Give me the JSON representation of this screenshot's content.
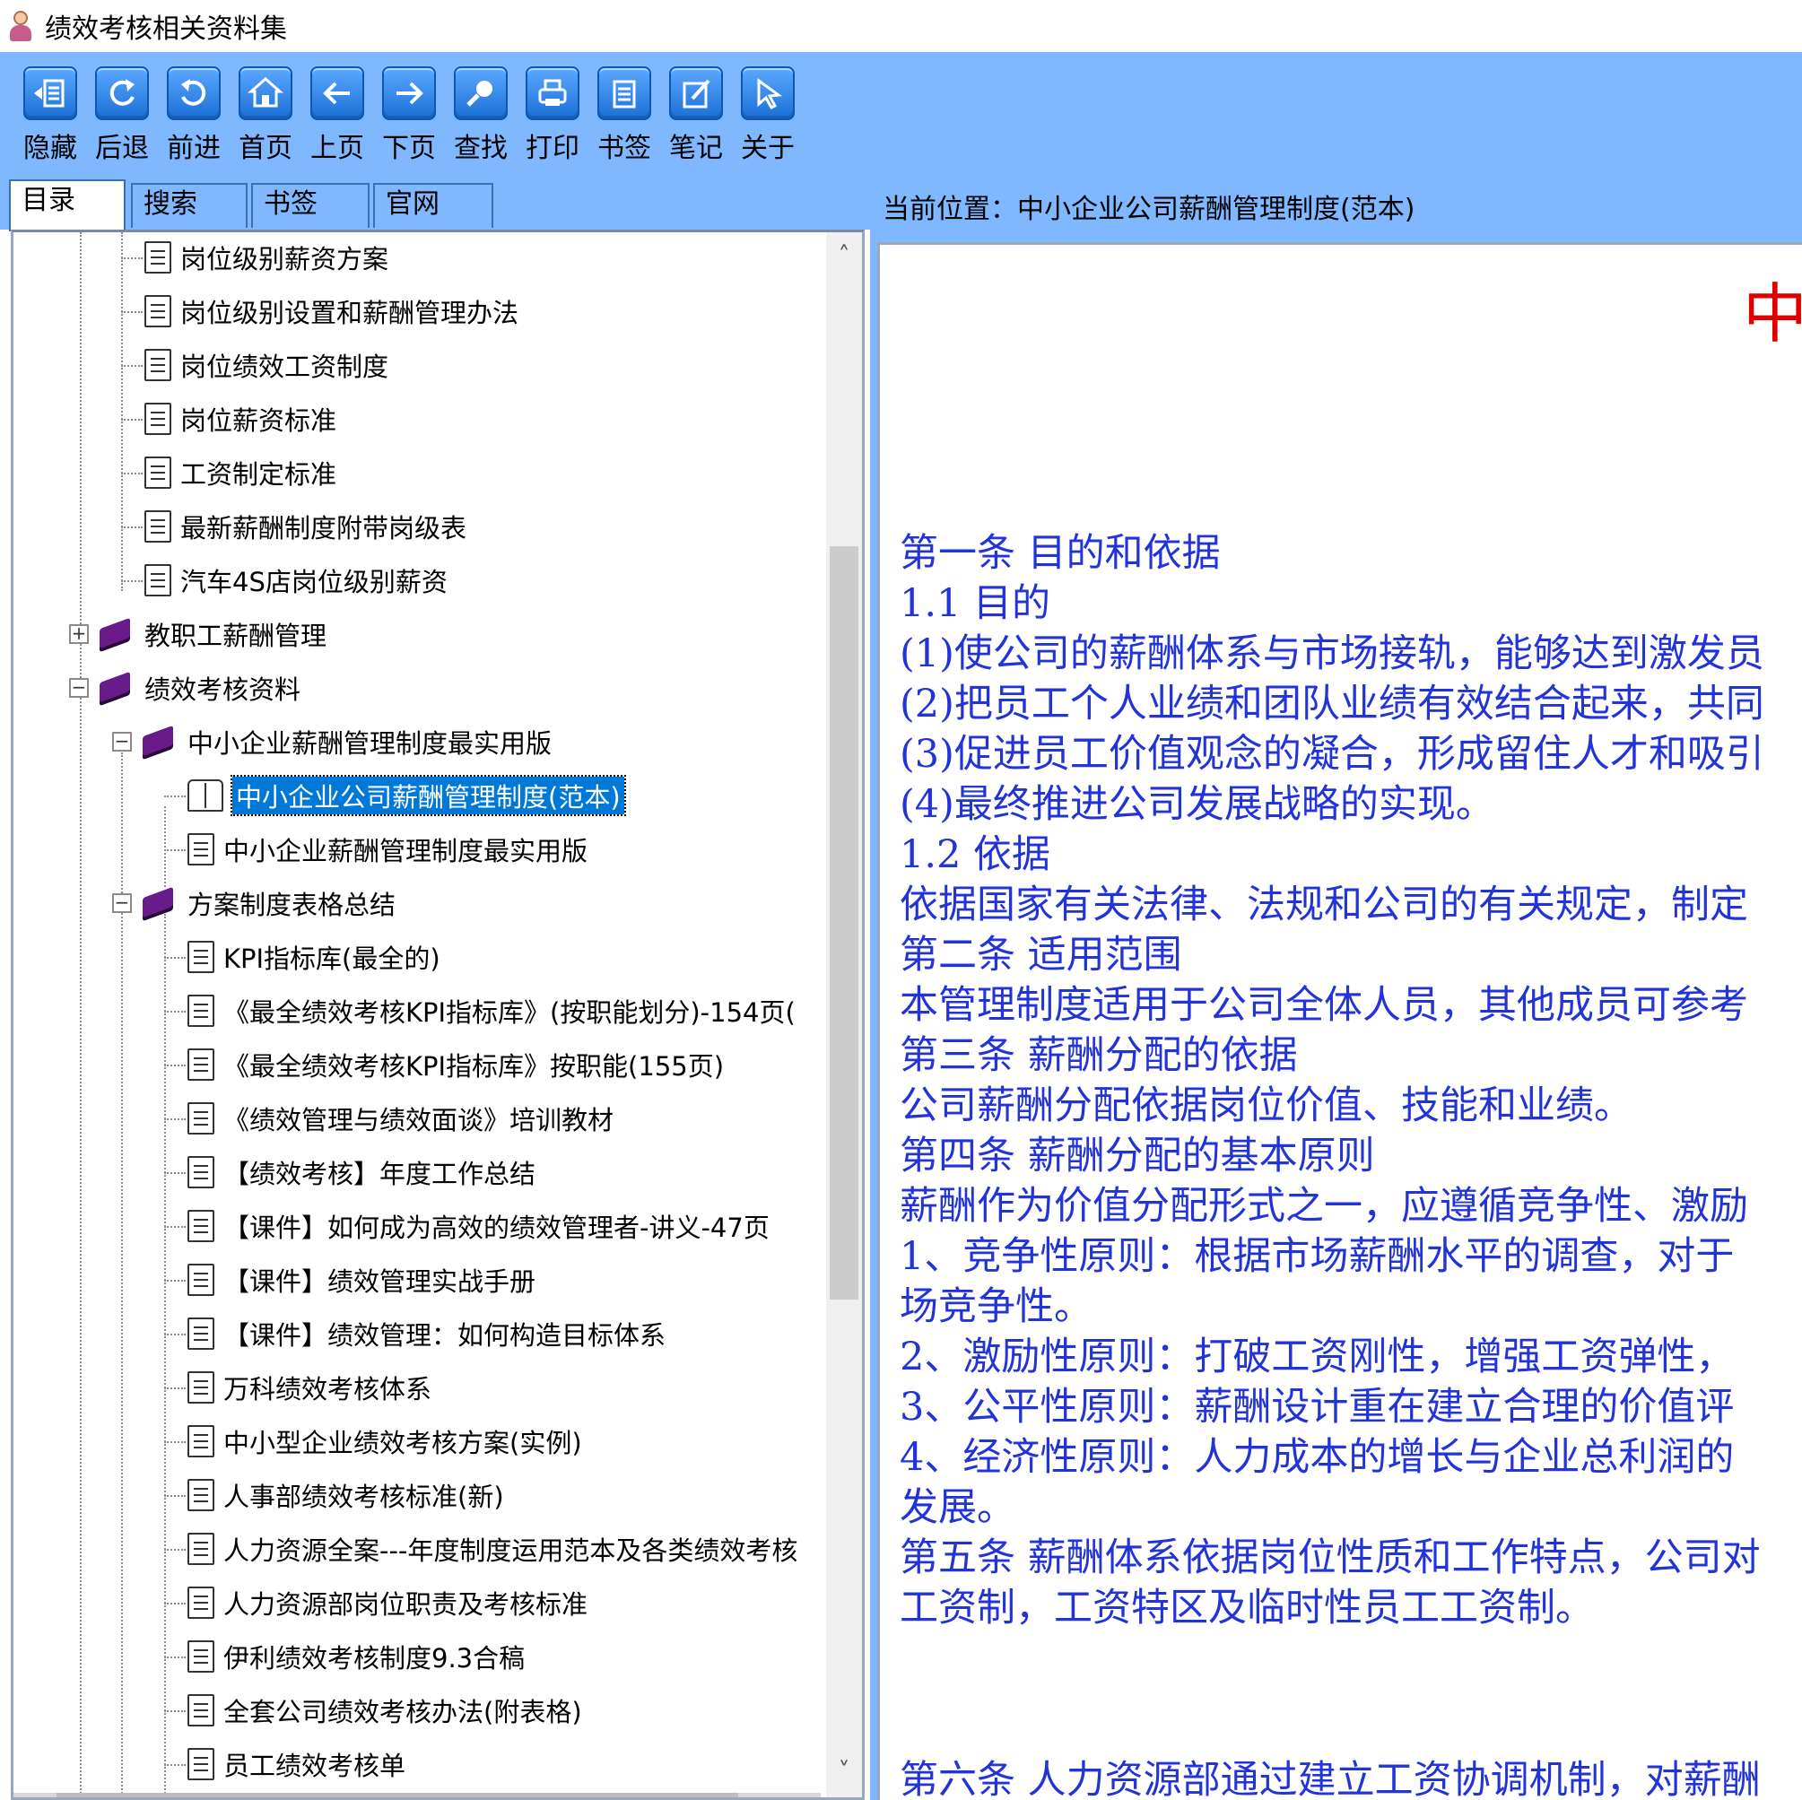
{
  "window": {
    "title": "绩效考核相关资料集"
  },
  "toolbar": {
    "buttons": [
      {
        "label": "隐藏",
        "icon": "hide-panel-icon"
      },
      {
        "label": "后退",
        "icon": "back-refresh-icon"
      },
      {
        "label": "前进",
        "icon": "forward-refresh-icon"
      },
      {
        "label": "首页",
        "icon": "home-icon"
      },
      {
        "label": "上页",
        "icon": "arrow-left-icon"
      },
      {
        "label": "下页",
        "icon": "arrow-right-icon"
      },
      {
        "label": "查找",
        "icon": "search-icon"
      },
      {
        "label": "打印",
        "icon": "printer-icon"
      },
      {
        "label": "书签",
        "icon": "bookmark-icon"
      },
      {
        "label": "笔记",
        "icon": "note-icon"
      },
      {
        "label": "关于",
        "icon": "cursor-icon"
      }
    ]
  },
  "tabs": [
    {
      "label": "目录"
    },
    {
      "label": "搜索"
    },
    {
      "label": "书签"
    },
    {
      "label": "官网"
    }
  ],
  "tree": {
    "items": [
      {
        "label": "岗位级别薪资方案"
      },
      {
        "label": "岗位级别设置和薪酬管理办法"
      },
      {
        "label": "岗位绩效工资制度"
      },
      {
        "label": "岗位薪资标准"
      },
      {
        "label": "工资制定标准"
      },
      {
        "label": "最新薪酬制度附带岗级表"
      },
      {
        "label": "汽车4S店岗位级别薪资"
      },
      {
        "label": "教职工薪酬管理"
      },
      {
        "label": "绩效考核资料"
      },
      {
        "label": "中小企业薪酬管理制度最实用版"
      },
      {
        "label": "中小企业公司薪酬管理制度(范本)"
      },
      {
        "label": "中小企业薪酬管理制度最实用版"
      },
      {
        "label": "方案制度表格总结"
      },
      {
        "label": "KPI指标库(最全的)"
      },
      {
        "label": "《最全绩效考核KPI指标库》(按职能划分)-154页("
      },
      {
        "label": "《最全绩效考核KPI指标库》按职能(155页)"
      },
      {
        "label": "《绩效管理与绩效面谈》培训教材"
      },
      {
        "label": "【绩效考核】年度工作总结"
      },
      {
        "label": "【课件】如何成为高效的绩效管理者-讲义-47页"
      },
      {
        "label": "【课件】绩效管理实战手册"
      },
      {
        "label": "【课件】绩效管理：如何构造目标体系"
      },
      {
        "label": "万科绩效考核体系"
      },
      {
        "label": "中小型企业绩效考核方案(实例)"
      },
      {
        "label": "人事部绩效考核标准(新)"
      },
      {
        "label": "人力资源全案---年度制度运用范本及各类绩效考核"
      },
      {
        "label": "人力资源部岗位职责及考核标准"
      },
      {
        "label": "伊利绩效考核制度9.3合稿"
      },
      {
        "label": "全套公司绩效考核办法(附表格)"
      },
      {
        "label": "员工绩效考核单"
      }
    ],
    "expander_collapsed": "+",
    "expander_expanded": "−",
    "scroll_up": "˄",
    "scroll_down": "˅"
  },
  "location": {
    "prefix": "当前位置：",
    "value": "中小企业公司薪酬管理制度(范本)"
  },
  "document": {
    "title_fragment": "中",
    "lines": [
      "第一条 目的和依据",
      "1.1  目的",
      "(1)使公司的薪酬体系与市场接轨，能够达到激发员",
      "(2)把员工个人业绩和团队业绩有效结合起来，共同",
      "(3)促进员工价值观念的凝合，形成留住人才和吸引",
      "(4)最终推进公司发展战略的实现。",
      "1.2 依据",
      "依据国家有关法律、法规和公司的有关规定，制定",
      "第二条 适用范围",
      "本管理制度适用于公司全体人员，其他成员可参考",
      "第三条 薪酬分配的依据",
      "公司薪酬分配依据岗位价值、技能和业绩。",
      "第四条 薪酬分配的基本原则",
      "薪酬作为价值分配形式之一，应遵循竞争性、激励",
      " 1、竞争性原则：根据市场薪酬水平的调查，对于",
      "场竞争性。",
      " 2、激励性原则：打破工资刚性，增强工资弹性，",
      " 3、公平性原则：薪酬设计重在建立合理的价值评",
      " 4、经济性原则：人力成本的增长与企业总利润的",
      "发展。",
      "第五条 薪酬体系依据岗位性质和工作特点，公司对",
      "工资制，工资特区及临时性员工工资制。"
    ],
    "bottom_cut_line": "第六条 人力资源部通过建立工资协调机制，对薪酬"
  },
  "colors": {
    "toolbar_bg": "#80b8ff",
    "selection": "#0078d7",
    "doc_text": "#2233d8",
    "doc_title": "#e00000"
  }
}
